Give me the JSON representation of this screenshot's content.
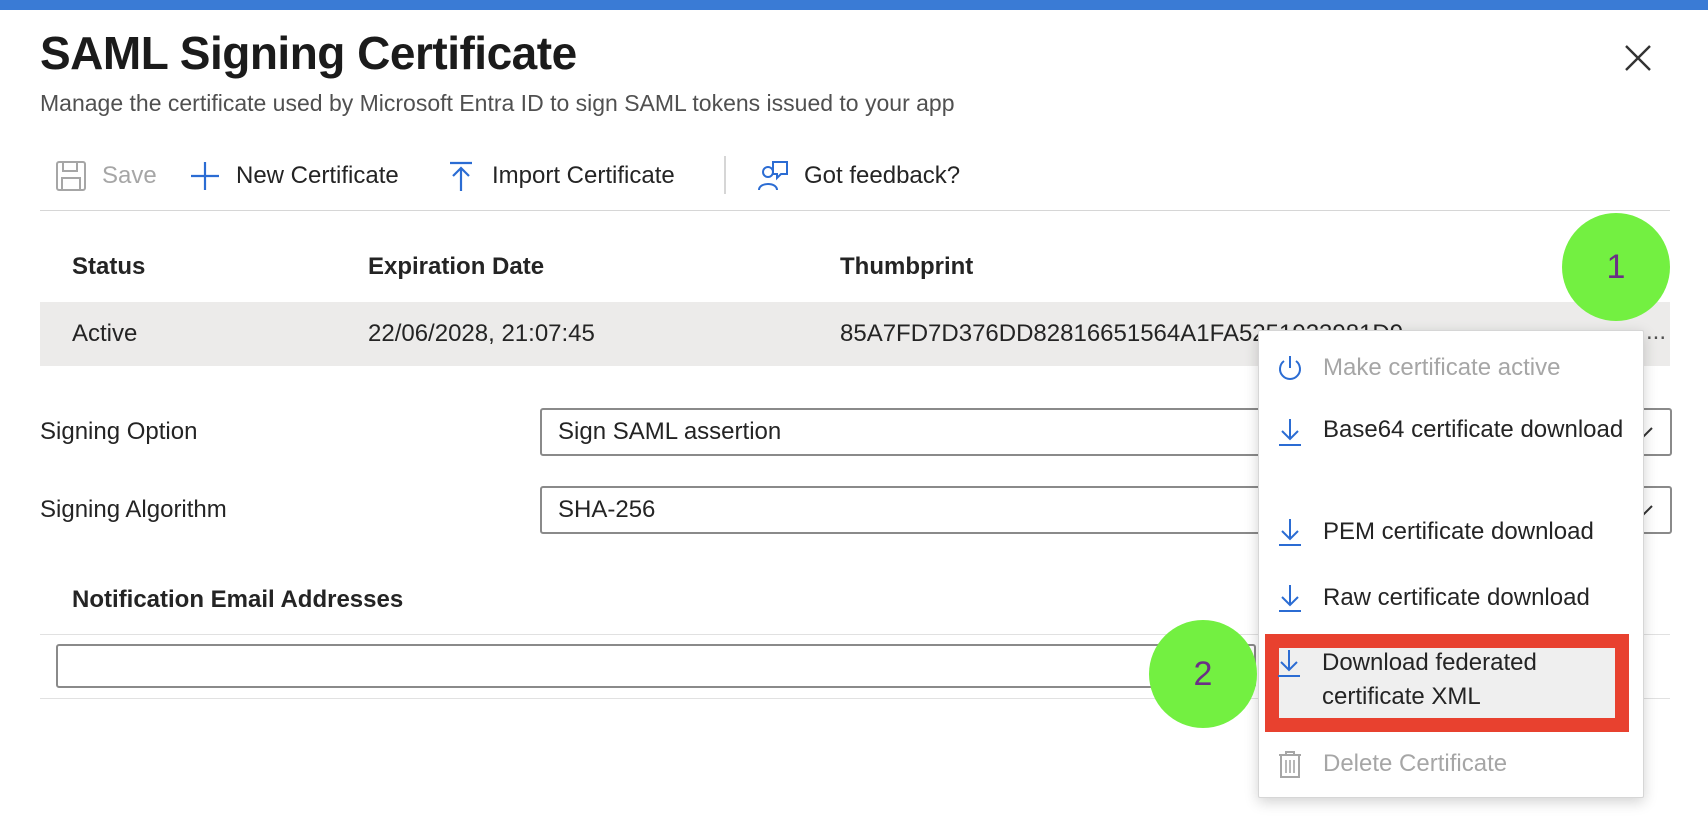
{
  "header": {
    "title": "SAML Signing Certificate",
    "subtitle": "Manage the certificate used by Microsoft Entra ID to sign SAML tokens issued to your app",
    "close_icon": "close-icon"
  },
  "toolbar": {
    "save_label": "Save",
    "new_certificate_label": "New Certificate",
    "import_certificate_label": "Import Certificate",
    "feedback_label": "Got feedback?"
  },
  "table": {
    "columns": [
      "Status",
      "Expiration Date",
      "Thumbprint"
    ],
    "rows": [
      {
        "status": "Active",
        "expiration": "22/06/2028, 21:07:45",
        "thumbprint": "85A7FD7D376DD82816651564A1FA5251923981D9"
      }
    ],
    "more_label": "..."
  },
  "signing_option": {
    "label": "Signing Option",
    "value": "Sign SAML assertion"
  },
  "signing_algorithm": {
    "label": "Signing Algorithm",
    "value": "SHA-256"
  },
  "notification": {
    "label": "Notification Email Addresses",
    "email_value": ""
  },
  "context_menu": {
    "items": [
      {
        "label": "Make certificate active",
        "icon": "power-icon",
        "disabled": true
      },
      {
        "label": "Base64 certificate download",
        "icon": "download-icon",
        "disabled": false
      },
      {
        "label": "PEM certificate download",
        "icon": "download-icon",
        "disabled": false
      },
      {
        "label": "Raw certificate download",
        "icon": "download-icon",
        "disabled": false
      },
      {
        "label": "Download federated certificate XML",
        "icon": "download-icon",
        "disabled": false,
        "highlighted": true
      },
      {
        "label": "Delete Certificate",
        "icon": "trash-icon",
        "disabled": true
      }
    ]
  },
  "annotations": {
    "step1": "1",
    "step2": "2"
  },
  "colors": {
    "accent": "#3a7bd5",
    "highlight_border": "#e8412f",
    "badge_fill": "#73f041",
    "badge_text": "#6b2f86"
  }
}
